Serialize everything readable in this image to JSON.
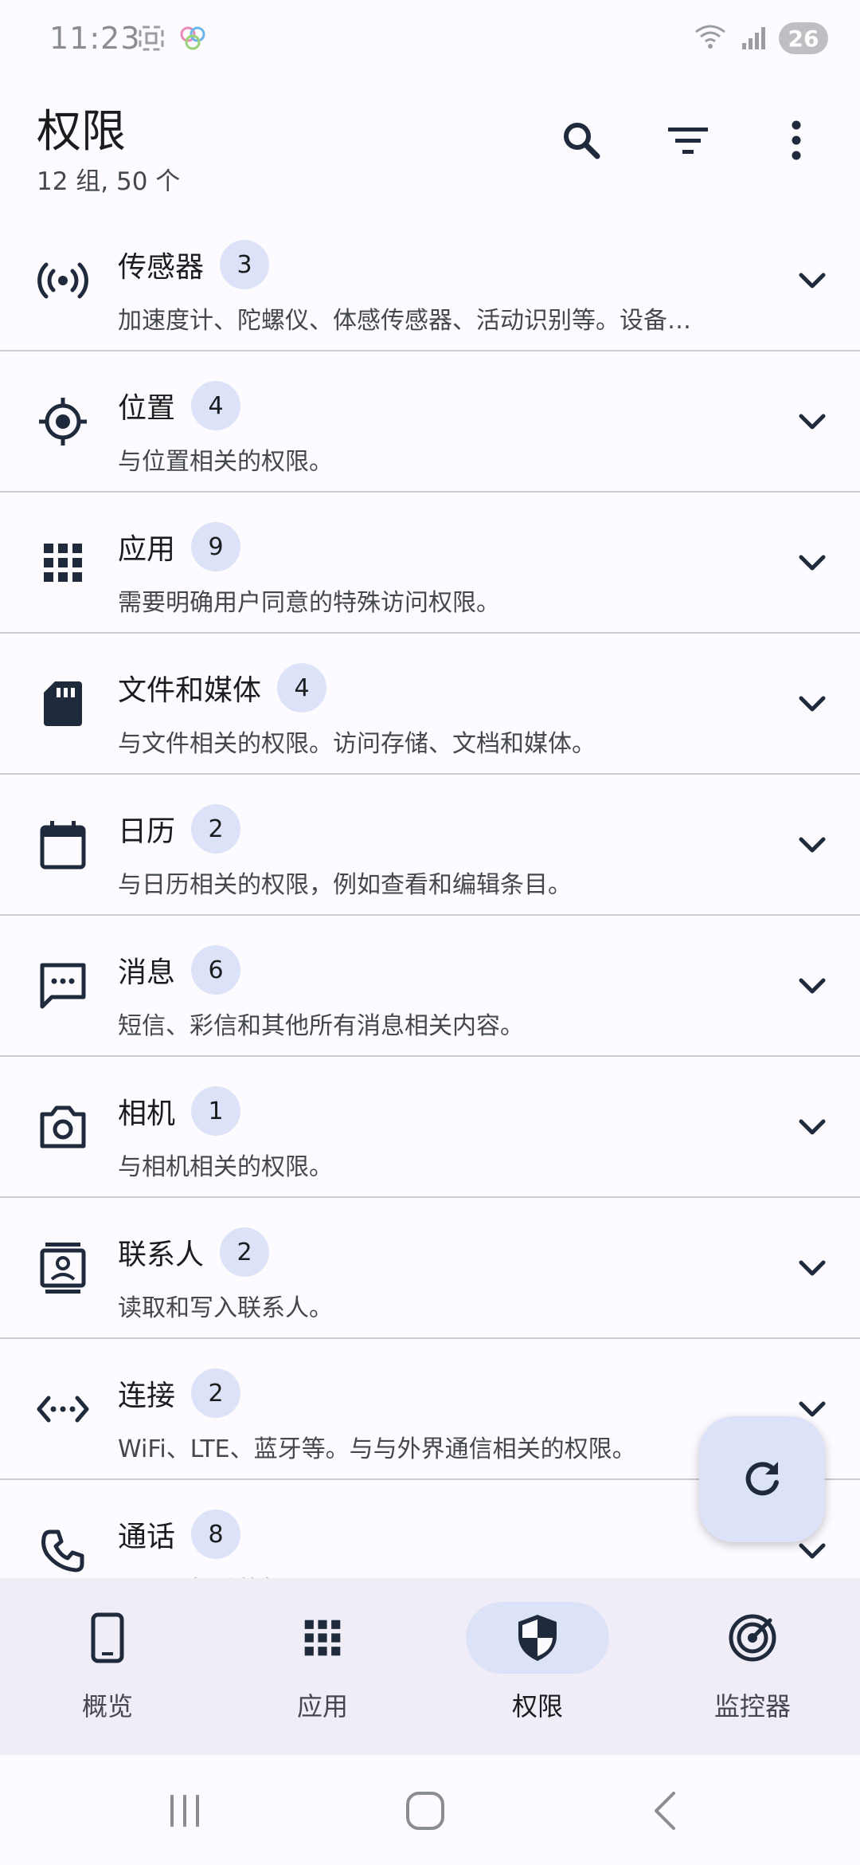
{
  "status_bar": {
    "time": "11:23",
    "battery": "26"
  },
  "header": {
    "title": "权限",
    "subtitle": "12 组, 50 个"
  },
  "groups": [
    {
      "title": "传感器",
      "count": "3",
      "desc": "加速度计、陀螺仪、体感传感器、活动识别等。设备…",
      "icon": "sensor-icon"
    },
    {
      "title": "位置",
      "count": "4",
      "desc": "与位置相关的权限。",
      "icon": "location-icon"
    },
    {
      "title": "应用",
      "count": "9",
      "desc": "需要明确用户同意的特殊访问权限。",
      "icon": "apps-grid-icon"
    },
    {
      "title": "文件和媒体",
      "count": "4",
      "desc": "与文件相关的权限。访问存储、文档和媒体。",
      "icon": "sd-card-icon"
    },
    {
      "title": "日历",
      "count": "2",
      "desc": "与日历相关的权限，例如查看和编辑条目。",
      "icon": "calendar-icon"
    },
    {
      "title": "消息",
      "count": "6",
      "desc": "短信、彩信和其他所有消息相关内容。",
      "icon": "message-icon"
    },
    {
      "title": "相机",
      "count": "1",
      "desc": "与相机相关的权限。",
      "icon": "camera-icon"
    },
    {
      "title": "联系人",
      "count": "2",
      "desc": "读取和写入联系人。",
      "icon": "contacts-icon"
    },
    {
      "title": "连接",
      "count": "2",
      "desc": "WiFi、LTE、蓝牙等。与与外界通信相关的权限。",
      "icon": "connection-icon"
    },
    {
      "title": "通话",
      "count": "8",
      "desc": "与通话相关的权限",
      "icon": "phone-icon"
    }
  ],
  "nav": {
    "items": [
      {
        "label": "概览",
        "icon": "phone-device-icon",
        "active": false
      },
      {
        "label": "应用",
        "icon": "apps-grid-icon",
        "active": false
      },
      {
        "label": "权限",
        "icon": "shield-icon",
        "active": true
      },
      {
        "label": "监控器",
        "icon": "radar-icon",
        "active": false
      }
    ]
  },
  "colors": {
    "accent_container": "#DCE3F9",
    "nav_background": "#F1EDF7",
    "icon": "#1F2A3C",
    "divider": "#C9CCD1"
  }
}
